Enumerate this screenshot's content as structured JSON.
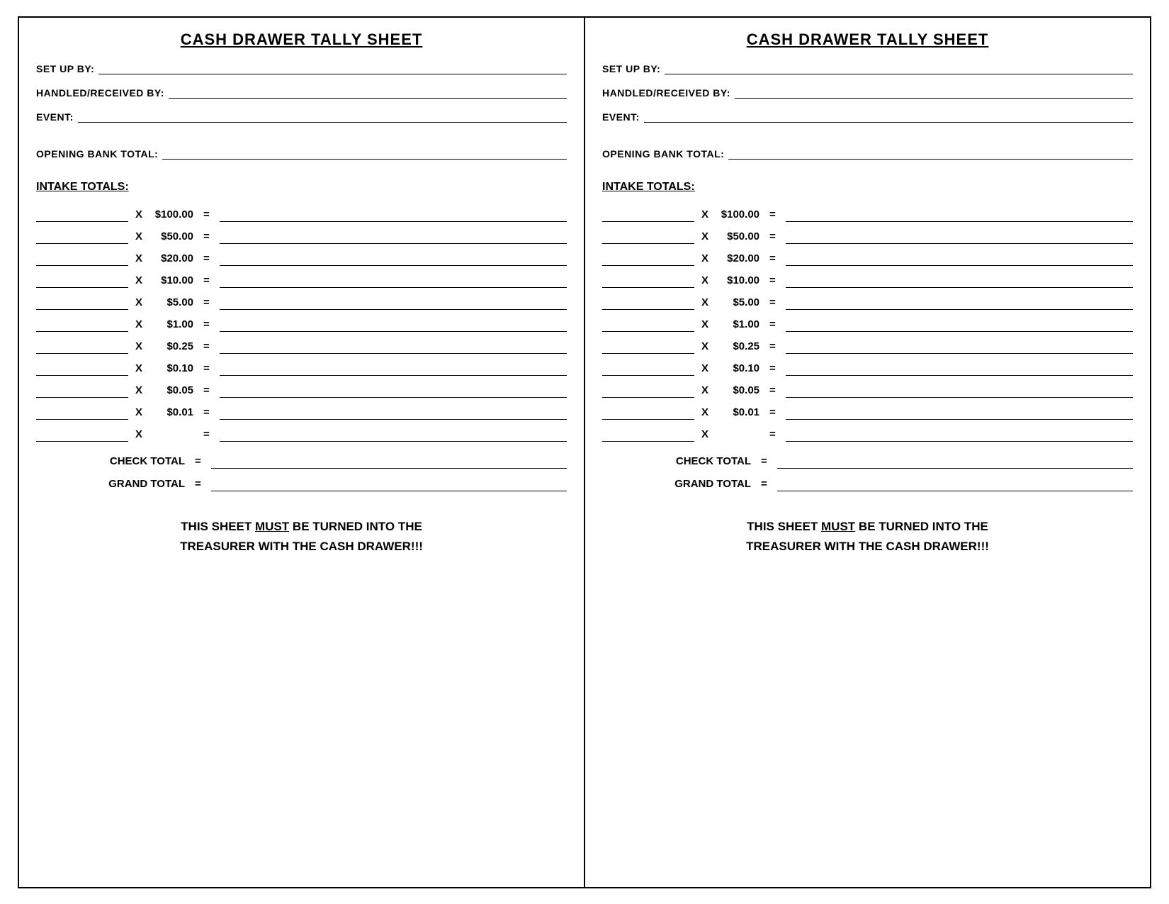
{
  "panels": [
    {
      "id": "left",
      "title": "CASH DRAWER TALLY SHEET",
      "set_up_by_label": "SET UP BY:",
      "handled_by_label": "HANDLED/RECEIVED BY:",
      "event_label": "EVENT:",
      "opening_bank_label": "OPENING BANK TOTAL:",
      "intake_label": "INTAKE TOTALS:",
      "rows": [
        {
          "amount": "$100.00"
        },
        {
          "amount": "$50.00"
        },
        {
          "amount": "$20.00"
        },
        {
          "amount": "$10.00"
        },
        {
          "amount": "$5.00"
        },
        {
          "amount": "$1.00"
        },
        {
          "amount": "$0.25"
        },
        {
          "amount": "$0.10"
        },
        {
          "amount": "$0.05"
        },
        {
          "amount": "$0.01"
        },
        {
          "amount": ""
        }
      ],
      "check_total_label": "CHECK TOTAL",
      "grand_total_label": "GRAND TOTAL",
      "x_label": "X",
      "eq_label": "=",
      "footer_line1": "THIS SHEET ",
      "footer_must": "MUST",
      "footer_line1b": " BE TURNED INTO THE",
      "footer_line2": "TREASURER WITH THE CASH DRAWER!!!"
    },
    {
      "id": "right",
      "title": "CASH DRAWER TALLY SHEET",
      "set_up_by_label": "SET UP BY:",
      "handled_by_label": "HANDLED/RECEIVED BY:",
      "event_label": "EVENT:",
      "opening_bank_label": "OPENING BANK TOTAL:",
      "intake_label": "INTAKE TOTALS:",
      "rows": [
        {
          "amount": "$100.00"
        },
        {
          "amount": "$50.00"
        },
        {
          "amount": "$20.00"
        },
        {
          "amount": "$10.00"
        },
        {
          "amount": "$5.00"
        },
        {
          "amount": "$1.00"
        },
        {
          "amount": "$0.25"
        },
        {
          "amount": "$0.10"
        },
        {
          "amount": "$0.05"
        },
        {
          "amount": "$0.01"
        },
        {
          "amount": ""
        }
      ],
      "check_total_label": "CHECK TOTAL",
      "grand_total_label": "GRAND TOTAL",
      "x_label": "X",
      "eq_label": "=",
      "footer_line1": "THIS SHEET ",
      "footer_must": "MUST",
      "footer_line1b": " BE TURNED INTO THE",
      "footer_line2": "TREASURER WITH THE CASH DRAWER!!!"
    }
  ]
}
